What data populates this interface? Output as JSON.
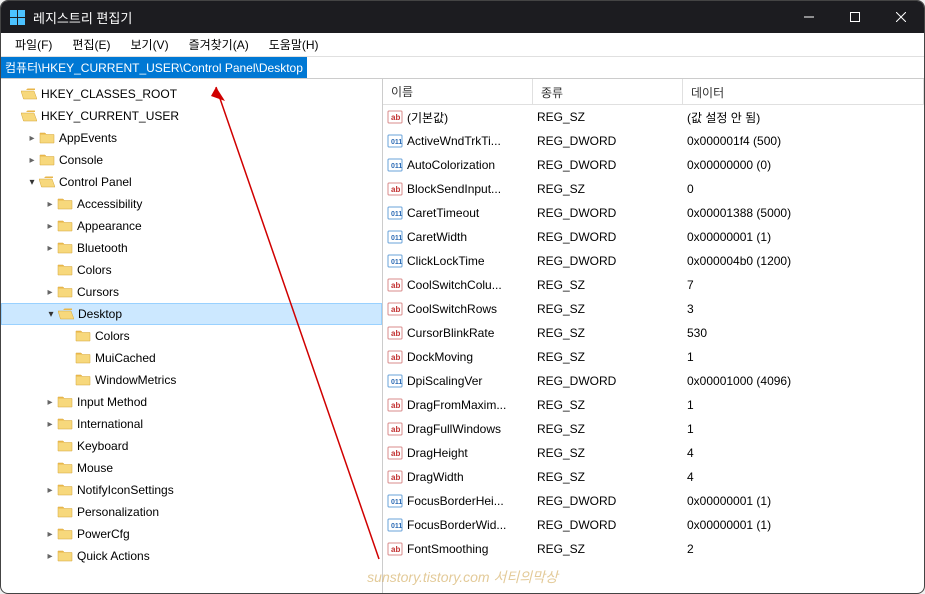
{
  "window": {
    "title": "레지스트리 편집기"
  },
  "menu": {
    "file": "파일(F)",
    "edit": "편집(E)",
    "view": "보기(V)",
    "favorites": "즐겨찾기(A)",
    "help": "도움말(H)"
  },
  "address": {
    "path": "컴퓨터\\HKEY_CURRENT_USER\\Control Panel\\Desktop"
  },
  "tree": [
    {
      "label": "HKEY_CLASSES_ROOT",
      "indent": 1,
      "chevron": "none",
      "open": true
    },
    {
      "label": "HKEY_CURRENT_USER",
      "indent": 1,
      "chevron": "none",
      "open": true
    },
    {
      "label": "AppEvents",
      "indent": 2,
      "chevron": "right"
    },
    {
      "label": "Console",
      "indent": 2,
      "chevron": "right"
    },
    {
      "label": "Control Panel",
      "indent": 2,
      "chevron": "down",
      "open": true
    },
    {
      "label": "Accessibility",
      "indent": 3,
      "chevron": "right"
    },
    {
      "label": "Appearance",
      "indent": 3,
      "chevron": "right"
    },
    {
      "label": "Bluetooth",
      "indent": 3,
      "chevron": "right"
    },
    {
      "label": "Colors",
      "indent": 3,
      "chevron": "blank"
    },
    {
      "label": "Cursors",
      "indent": 3,
      "chevron": "right"
    },
    {
      "label": "Desktop",
      "indent": 3,
      "chevron": "down",
      "open": true,
      "selected": true
    },
    {
      "label": "Colors",
      "indent": 4,
      "chevron": "blank"
    },
    {
      "label": "MuiCached",
      "indent": 4,
      "chevron": "blank"
    },
    {
      "label": "WindowMetrics",
      "indent": 4,
      "chevron": "blank"
    },
    {
      "label": "Input Method",
      "indent": 3,
      "chevron": "right"
    },
    {
      "label": "International",
      "indent": 3,
      "chevron": "right"
    },
    {
      "label": "Keyboard",
      "indent": 3,
      "chevron": "blank"
    },
    {
      "label": "Mouse",
      "indent": 3,
      "chevron": "blank"
    },
    {
      "label": "NotifyIconSettings",
      "indent": 3,
      "chevron": "right"
    },
    {
      "label": "Personalization",
      "indent": 3,
      "chevron": "blank"
    },
    {
      "label": "PowerCfg",
      "indent": 3,
      "chevron": "right"
    },
    {
      "label": "Quick Actions",
      "indent": 3,
      "chevron": "right"
    }
  ],
  "list": {
    "headers": {
      "name": "이름",
      "type": "종류",
      "data": "데이터"
    },
    "rows": [
      {
        "name": "(기본값)",
        "type": "REG_SZ",
        "data": "(값 설정 안 됨)",
        "icon": "sz"
      },
      {
        "name": "ActiveWndTrkTi...",
        "type": "REG_DWORD",
        "data": "0x000001f4 (500)",
        "icon": "dw"
      },
      {
        "name": "AutoColorization",
        "type": "REG_DWORD",
        "data": "0x00000000 (0)",
        "icon": "dw"
      },
      {
        "name": "BlockSendInput...",
        "type": "REG_SZ",
        "data": "0",
        "icon": "sz"
      },
      {
        "name": "CaretTimeout",
        "type": "REG_DWORD",
        "data": "0x00001388 (5000)",
        "icon": "dw"
      },
      {
        "name": "CaretWidth",
        "type": "REG_DWORD",
        "data": "0x00000001 (1)",
        "icon": "dw"
      },
      {
        "name": "ClickLockTime",
        "type": "REG_DWORD",
        "data": "0x000004b0 (1200)",
        "icon": "dw"
      },
      {
        "name": "CoolSwitchColu...",
        "type": "REG_SZ",
        "data": "7",
        "icon": "sz"
      },
      {
        "name": "CoolSwitchRows",
        "type": "REG_SZ",
        "data": "3",
        "icon": "sz"
      },
      {
        "name": "CursorBlinkRate",
        "type": "REG_SZ",
        "data": "530",
        "icon": "sz"
      },
      {
        "name": "DockMoving",
        "type": "REG_SZ",
        "data": "1",
        "icon": "sz"
      },
      {
        "name": "DpiScalingVer",
        "type": "REG_DWORD",
        "data": "0x00001000 (4096)",
        "icon": "dw"
      },
      {
        "name": "DragFromMaxim...",
        "type": "REG_SZ",
        "data": "1",
        "icon": "sz"
      },
      {
        "name": "DragFullWindows",
        "type": "REG_SZ",
        "data": "1",
        "icon": "sz"
      },
      {
        "name": "DragHeight",
        "type": "REG_SZ",
        "data": "4",
        "icon": "sz"
      },
      {
        "name": "DragWidth",
        "type": "REG_SZ",
        "data": "4",
        "icon": "sz"
      },
      {
        "name": "FocusBorderHei...",
        "type": "REG_DWORD",
        "data": "0x00000001 (1)",
        "icon": "dw"
      },
      {
        "name": "FocusBorderWid...",
        "type": "REG_DWORD",
        "data": "0x00000001 (1)",
        "icon": "dw"
      },
      {
        "name": "FontSmoothing",
        "type": "REG_SZ",
        "data": "2",
        "icon": "sz"
      }
    ]
  },
  "watermark": "sunstory.tistory.com 서티의막상"
}
